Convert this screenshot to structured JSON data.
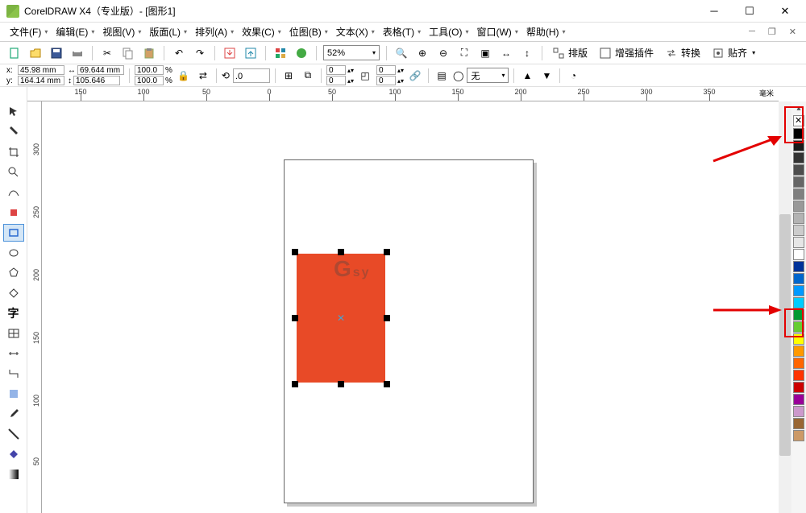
{
  "title": "CorelDRAW X4（专业版）- [图形1]",
  "menu": {
    "file": "文件(F)",
    "edit": "编辑(E)",
    "view": "视图(V)",
    "layout": "版面(L)",
    "arrange": "排列(A)",
    "effects": "效果(C)",
    "bitmap": "位图(B)",
    "text": "文本(X)",
    "table": "表格(T)",
    "tools": "工具(O)",
    "window": "窗口(W)",
    "help": "帮助(H)"
  },
  "toolbar": {
    "zoom": "52%",
    "snap_label": "排版",
    "enhance_label": "增强插件",
    "convert_label": "转换",
    "align_label": "贴齐"
  },
  "props": {
    "x": "45.98 mm",
    "y": "164.14 mm",
    "w": "69.644 mm",
    "h": "105.646 mm",
    "sx": "100.0",
    "sy": "100.0",
    "rotation": ".0",
    "cols": "0",
    "rows": "0",
    "fill": "无"
  },
  "ruler_h": [
    {
      "p": 66,
      "v": "150"
    },
    {
      "p": 144,
      "v": "100"
    },
    {
      "p": 222,
      "v": "50"
    },
    {
      "p": 300,
      "v": "0"
    },
    {
      "p": 378,
      "v": "50"
    },
    {
      "p": 456,
      "v": "100"
    },
    {
      "p": 534,
      "v": "150"
    },
    {
      "p": 612,
      "v": "200"
    },
    {
      "p": 690,
      "v": "250"
    },
    {
      "p": 768,
      "v": "300"
    },
    {
      "p": 846,
      "v": "350"
    }
  ],
  "ruler_v": [
    {
      "p": 42,
      "v": "300"
    },
    {
      "p": 120,
      "v": "250"
    },
    {
      "p": 198,
      "v": "200"
    },
    {
      "p": 276,
      "v": "150"
    },
    {
      "p": 354,
      "v": "100"
    },
    {
      "p": 432,
      "v": "50"
    }
  ],
  "ruler_unit": "毫米",
  "palette": [
    "#000000",
    "#1a1a1a",
    "#333333",
    "#4d4d4d",
    "#666666",
    "#808080",
    "#999999",
    "#b3b3b3",
    "#cccccc",
    "#e6e6e6",
    "#ffffff",
    "#003399",
    "#0066cc",
    "#0099ff",
    "#00ccff",
    "#009933",
    "#66cc33",
    "#ffff00",
    "#ff9900",
    "#ff6600",
    "#ff3300",
    "#cc0000",
    "#990099",
    "#cc99cc",
    "#996633",
    "#cc9966"
  ],
  "watermark": {
    "main": "G",
    "sub": "sy"
  }
}
